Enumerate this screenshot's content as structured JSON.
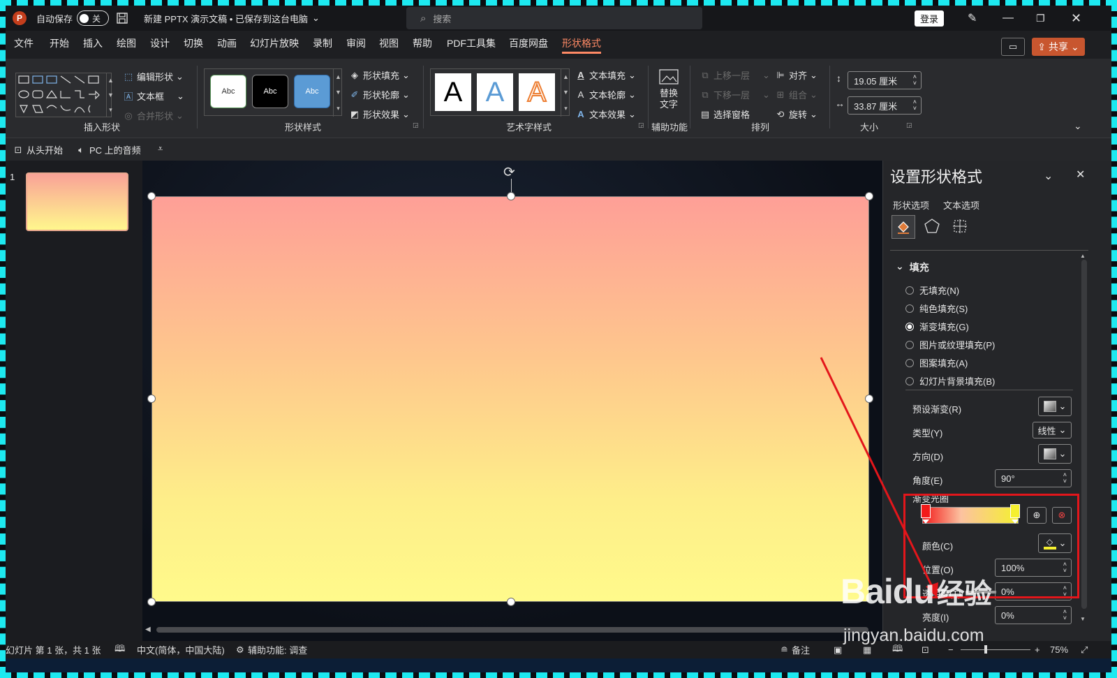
{
  "titlebar": {
    "autosave_label": "自动保存",
    "autosave_state": "关",
    "doc_title": "新建 PPTX 演示文稿 • 已保存到这台电脑",
    "search_placeholder": "搜索",
    "login": "登录"
  },
  "menu": {
    "items": [
      "文件",
      "开始",
      "插入",
      "绘图",
      "设计",
      "切换",
      "动画",
      "幻灯片放映",
      "录制",
      "审阅",
      "视图",
      "帮助",
      "PDF工具集",
      "百度网盘",
      "形状格式"
    ],
    "active": "形状格式",
    "share": "共享"
  },
  "ribbon": {
    "insert_shapes": {
      "label": "插入形状",
      "edit_shape": "编辑形状",
      "textbox": "文本框",
      "merge_shapes": "合并形状"
    },
    "shape_styles": {
      "label": "形状样式",
      "swatch": "Abc",
      "fill": "形状填充",
      "outline": "形状轮廓",
      "effects": "形状效果"
    },
    "wordart": {
      "label": "艺术字样式",
      "letter": "A",
      "text_fill": "文本填充",
      "text_outline": "文本轮廓",
      "text_effects": "文本效果"
    },
    "accessibility": {
      "label": "辅助功能",
      "alt_text_line1": "替换",
      "alt_text_line2": "文字"
    },
    "arrange": {
      "label": "排列",
      "bring_forward": "上移一层",
      "send_backward": "下移一层",
      "selection_pane": "选择窗格",
      "align": "对齐",
      "group": "组合",
      "rotate": "旋转"
    },
    "size": {
      "label": "大小",
      "height": "19.05 厘米",
      "width": "33.87 厘米"
    }
  },
  "qat": {
    "from_start": "从头开始",
    "audio": "PC 上的音频"
  },
  "slides": {
    "number": "1"
  },
  "panel": {
    "title": "设置形状格式",
    "tab_shape": "形状选项",
    "tab_text": "文本选项",
    "section_fill": "填充",
    "fill_options": [
      {
        "label": "无填充(N)",
        "selected": false
      },
      {
        "label": "纯色填充(S)",
        "selected": false
      },
      {
        "label": "渐变填充(G)",
        "selected": true
      },
      {
        "label": "图片或纹理填充(P)",
        "selected": false
      },
      {
        "label": "图案填充(A)",
        "selected": false
      },
      {
        "label": "幻灯片背景填充(B)",
        "selected": false
      }
    ],
    "preset_gradient": "预设渐变(R)",
    "type_label": "类型(Y)",
    "type_value": "线性",
    "direction": "方向(D)",
    "angle_label": "角度(E)",
    "angle_value": "90°",
    "stops_label": "渐变光圈",
    "color_label": "颜色(C)",
    "position_label": "位置(O)",
    "position_value": "100%",
    "transparency_label": "透明度(T)",
    "transparency_value": "0%",
    "brightness_label": "亮度(I)",
    "brightness_value": "0%"
  },
  "gradient": {
    "start_color": "#f21a1a",
    "end_color": "#f5f030"
  },
  "status": {
    "slide_info": "幻灯片 第 1 张，共 1 张",
    "language": "中文(简体，中国大陆)",
    "accessibility": "辅助功能: 调查",
    "notes": "备注",
    "zoom": "75%"
  },
  "watermark": {
    "brand": "Baidu",
    "brand_cn": "经验",
    "url": "jingyan.baidu.com"
  }
}
